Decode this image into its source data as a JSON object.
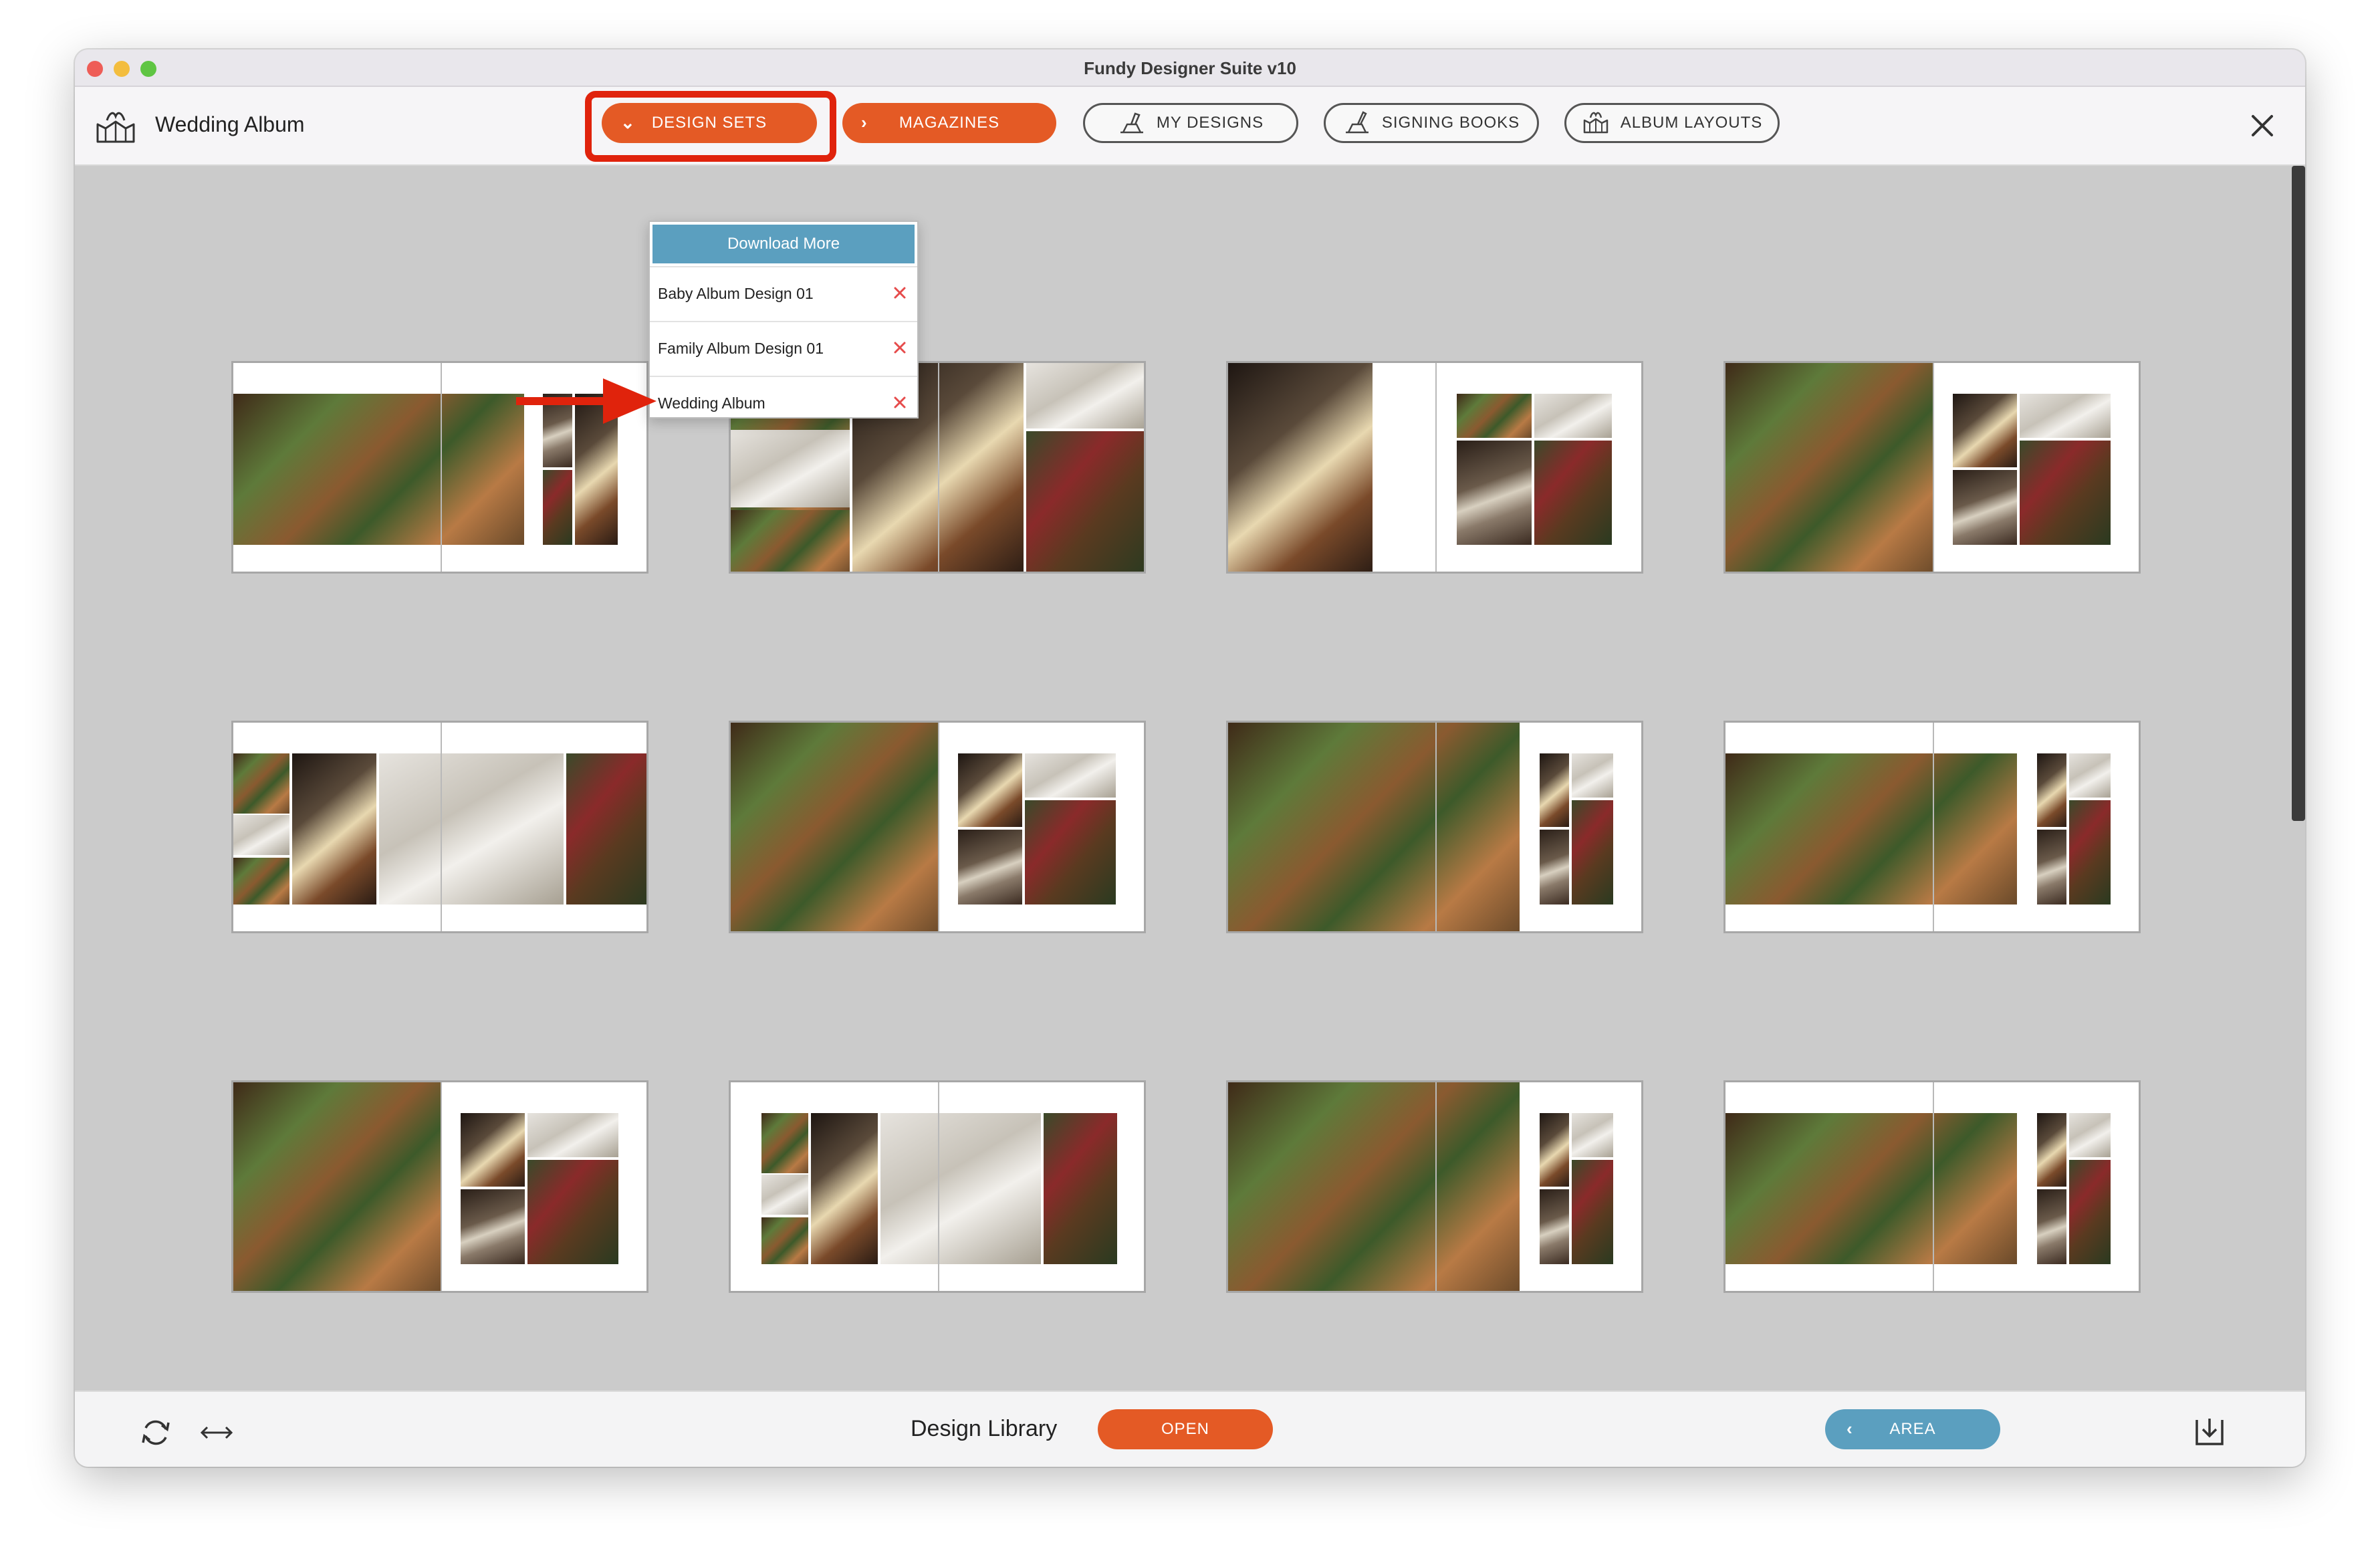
{
  "window": {
    "title": "Fundy Designer Suite v10"
  },
  "toolbar": {
    "app_name": "Wedding Album",
    "app_icon": "album-book-icon",
    "tabs": [
      {
        "label": "DESIGN SETS",
        "icon": "chevron-down-icon"
      },
      {
        "label": "MAGAZINES",
        "icon": "chevron-right-icon"
      },
      {
        "label": "MY DESIGNS",
        "icon": "hand-album-icon"
      },
      {
        "label": "SIGNING BOOKS",
        "icon": "hand-pen-icon"
      },
      {
        "label": "ALBUM LAYOUTS",
        "icon": "album-layouts-icon"
      }
    ],
    "close_icon": "close-icon"
  },
  "dropdown": {
    "download_label": "Download More",
    "items": [
      {
        "label": "Baby Album Design 01"
      },
      {
        "label": "Family Album Design 01"
      },
      {
        "label": "Wedding Album"
      }
    ],
    "remove_icon": "remove-x-icon"
  },
  "footer": {
    "title": "Design Library",
    "open_label": "OPEN",
    "area_label": "AREA",
    "refresh_icon": "refresh-icon",
    "resize_icon": "horizontal-arrows-icon",
    "download_icon": "download-icon"
  },
  "colors": {
    "accent_orange": "#e45a25",
    "accent_blue": "#5b9fbf",
    "highlight_red": "#e0230c"
  }
}
